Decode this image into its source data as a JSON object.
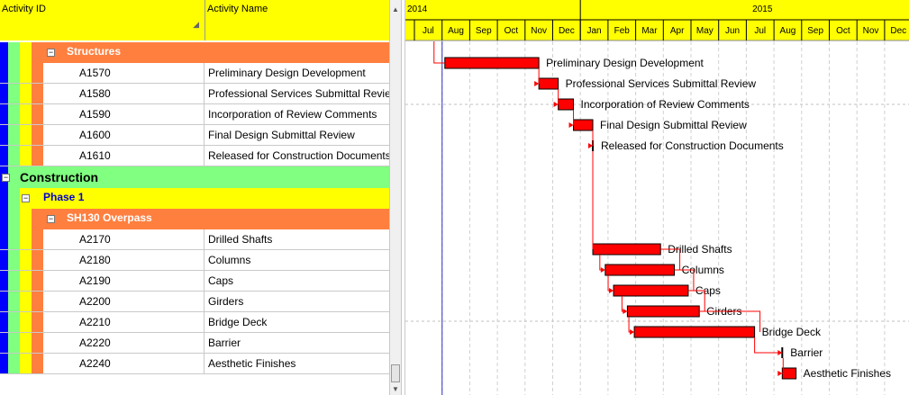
{
  "columns": {
    "activity_id": "Activity ID",
    "activity_name": "Activity Name"
  },
  "colors": {
    "header": "#ffff00",
    "wbs_orange": "#ff7f3f",
    "wbs_green": "#80ff80",
    "wbs_yellow": "#ffff00",
    "bar": "#ff0000",
    "link": "#ff0000",
    "today_line": "#3030c0",
    "phase_text": "#0000cc"
  },
  "timescale": {
    "years": [
      "2014",
      "2015"
    ],
    "months": [
      "Jul",
      "Aug",
      "Sep",
      "Oct",
      "Nov",
      "Dec",
      "Jan",
      "Feb",
      "Mar",
      "Apr",
      "May",
      "Jun",
      "Jul",
      "Aug",
      "Sep",
      "Oct",
      "Nov",
      "Dec"
    ]
  },
  "groups": {
    "structures": "Structures",
    "construction": "Construction",
    "phase1": "Phase 1",
    "overpass": "SH130 Overpass"
  },
  "structures_activities": [
    {
      "id": "A1570",
      "name": "Preliminary Design Development"
    },
    {
      "id": "A1580",
      "name": "Professional Services Submittal Review"
    },
    {
      "id": "A1590",
      "name": "Incorporation of Review Comments"
    },
    {
      "id": "A1600",
      "name": "Final Design Submittal Review"
    },
    {
      "id": "A1610",
      "name": "Released for Construction Documents"
    }
  ],
  "overpass_activities": [
    {
      "id": "A2170",
      "name": "Drilled Shafts"
    },
    {
      "id": "A2180",
      "name": "Columns"
    },
    {
      "id": "A2190",
      "name": "Caps"
    },
    {
      "id": "A2200",
      "name": "Girders"
    },
    {
      "id": "A2210",
      "name": "Bridge Deck"
    },
    {
      "id": "A2220",
      "name": "Barrier"
    },
    {
      "id": "A2240",
      "name": "Aesthetic Finishes"
    }
  ],
  "schedule": [
    {
      "label": "Preliminary Design Development",
      "start": 1.1,
      "end": 4.5,
      "milestone": false
    },
    {
      "label": "Professional Services Submittal Review",
      "start": 4.5,
      "end": 5.2,
      "milestone": false
    },
    {
      "label": "Incorporation of Review Comments",
      "start": 5.2,
      "end": 5.75,
      "milestone": false
    },
    {
      "label": "Final Design Submittal Review",
      "start": 5.75,
      "end": 6.45,
      "milestone": false
    },
    {
      "label": "Released for Construction Documents",
      "start": 6.45,
      "end": 6.45,
      "milestone": true
    },
    {
      "label": "Drilled Shafts",
      "start": 6.45,
      "end": 8.9,
      "milestone": false
    },
    {
      "label": "Columns",
      "start": 6.9,
      "end": 9.4,
      "milestone": false
    },
    {
      "label": "Caps",
      "start": 7.2,
      "end": 9.9,
      "milestone": false
    },
    {
      "label": "Girders",
      "start": 7.7,
      "end": 10.3,
      "milestone": false
    },
    {
      "label": "Bridge Deck",
      "start": 7.95,
      "end": 12.3,
      "milestone": false
    },
    {
      "label": "Barrier",
      "start": 13.3,
      "end": 13.3,
      "milestone": true
    },
    {
      "label": "Aesthetic Finishes",
      "start": 13.3,
      "end": 13.8,
      "milestone": false
    }
  ]
}
